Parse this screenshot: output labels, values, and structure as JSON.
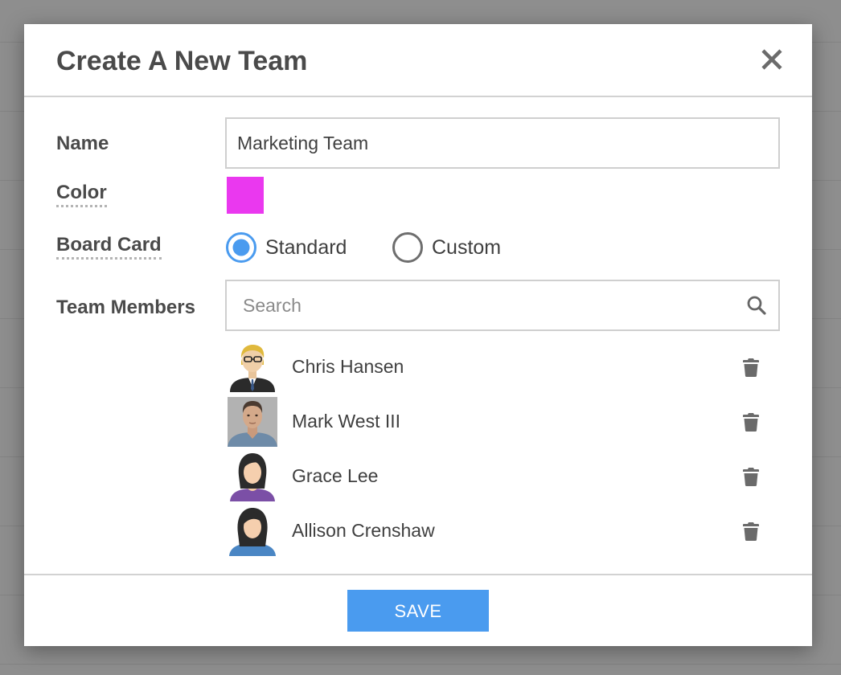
{
  "dialog": {
    "title": "Create A New Team",
    "close_icon": "close-icon"
  },
  "form": {
    "name": {
      "label": "Name",
      "value": "Marketing Team"
    },
    "color": {
      "label": "Color",
      "value": "#ea38ef"
    },
    "board_card": {
      "label": "Board Card",
      "options": [
        {
          "label": "Standard",
          "selected": true
        },
        {
          "label": "Custom",
          "selected": false
        }
      ]
    },
    "team_members": {
      "label": "Team Members",
      "search_placeholder": "Search",
      "search_icon": "search-icon",
      "members": [
        {
          "name": "Chris Hansen",
          "avatar": "avatar-blonde-man-glasses-suit"
        },
        {
          "name": "Mark West III",
          "avatar": "avatar-photo-man"
        },
        {
          "name": "Grace Lee",
          "avatar": "avatar-dark-hair-woman-purple"
        },
        {
          "name": "Allison Crenshaw",
          "avatar": "avatar-dark-hair-woman-blue"
        }
      ],
      "remove_icon": "trash-icon"
    }
  },
  "footer": {
    "save_label": "SAVE"
  },
  "colors": {
    "accent": "#4a9bef",
    "overlay": "#8e8e8e",
    "text": "#4a4a4a"
  }
}
